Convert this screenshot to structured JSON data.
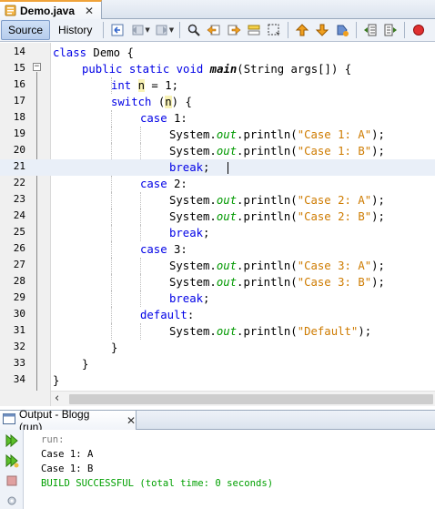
{
  "editor_tab": {
    "filename": "Demo.java",
    "close_glyph": "✕"
  },
  "toolbar": {
    "source_label": "Source",
    "history_label": "History",
    "icons": [
      "last-edit-icon",
      "back-icon",
      "forward-icon",
      "find-icon",
      "find-previous-icon",
      "find-next-icon",
      "toggle-highlight-icon",
      "toggle-rect-select-icon",
      "previous-bookmark-icon",
      "next-bookmark-icon",
      "toggle-bookmark-icon",
      "shift-left-icon",
      "shift-right-icon",
      "stop-macro-icon"
    ]
  },
  "lines": [
    {
      "n": "14"
    },
    {
      "n": "15"
    },
    {
      "n": "16"
    },
    {
      "n": "17"
    },
    {
      "n": "18"
    },
    {
      "n": "19"
    },
    {
      "n": "20"
    },
    {
      "n": "21"
    },
    {
      "n": "22"
    },
    {
      "n": "23"
    },
    {
      "n": "24"
    },
    {
      "n": "25"
    },
    {
      "n": "26"
    },
    {
      "n": "27"
    },
    {
      "n": "28"
    },
    {
      "n": "29"
    },
    {
      "n": "30"
    },
    {
      "n": "31"
    },
    {
      "n": "32"
    },
    {
      "n": "33"
    },
    {
      "n": "34"
    }
  ],
  "code": {
    "l14": {
      "kw": "class",
      "rest": " Demo {"
    },
    "l15": {
      "kw": "public static void",
      "mth": "main",
      "rest": "(String args[]) {"
    },
    "l16": {
      "kw": "int",
      "var": "n",
      "rest": " = 1;"
    },
    "l17": {
      "kw": "switch",
      "open": " (",
      "var": "n",
      "rest": ") {"
    },
    "l18": {
      "kw": "case",
      "rest": " 1:"
    },
    "l19": {
      "pre": "System.",
      "fld": "out",
      "mid": ".println(",
      "str": "\"Case 1: A\"",
      "post": ");"
    },
    "l20": {
      "pre": "System.",
      "fld": "out",
      "mid": ".println(",
      "str": "\"Case 1: B\"",
      "post": ");"
    },
    "l21": {
      "kw": "break",
      "rest": ";"
    },
    "l22": {
      "kw": "case",
      "rest": " 2:"
    },
    "l23": {
      "pre": "System.",
      "fld": "out",
      "mid": ".println(",
      "str": "\"Case 2: A\"",
      "post": ");"
    },
    "l24": {
      "pre": "System.",
      "fld": "out",
      "mid": ".println(",
      "str": "\"Case 2: B\"",
      "post": ");"
    },
    "l25": {
      "kw": "break",
      "rest": ";"
    },
    "l26": {
      "kw": "case",
      "rest": " 3:"
    },
    "l27": {
      "pre": "System.",
      "fld": "out",
      "mid": ".println(",
      "str": "\"Case 3: A\"",
      "post": ");"
    },
    "l28": {
      "pre": "System.",
      "fld": "out",
      "mid": ".println(",
      "str": "\"Case 3: B\"",
      "post": ");"
    },
    "l29": {
      "kw": "break",
      "rest": ";"
    },
    "l30": {
      "kw": "default",
      "rest": ":"
    },
    "l31": {
      "pre": "System.",
      "fld": "out",
      "mid": ".println(",
      "str": "\"Default\"",
      "post": ");"
    },
    "l32": {
      "rest": "}"
    },
    "l33": {
      "rest": "}"
    },
    "l34": {
      "rest": "}"
    }
  },
  "output": {
    "tab_label": "Output - Blogg (run)",
    "close_glyph": "✕",
    "lines": [
      "run:",
      "Case 1: A",
      "Case 1: B",
      "BUILD SUCCESSFUL (total time: 0 seconds)"
    ]
  },
  "colors": {
    "keyword": "#0000e6",
    "string": "#ce7b00",
    "field": "#009900",
    "build_success": "#00a000",
    "current_line": "#e9eff8"
  }
}
